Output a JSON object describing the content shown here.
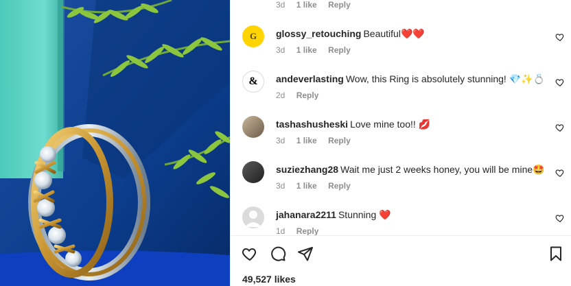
{
  "post": {
    "image_alt": "Gold and platinum diamond ring on turquoise and blue background with evergreen branches"
  },
  "comments": [
    {
      "username": "",
      "text": "",
      "time": "3d",
      "likes": "1 like",
      "reply": "Reply",
      "avatar": "dark-avatar"
    },
    {
      "username": "glossy_retouching",
      "text": "Beautiful",
      "emoji": "❤️❤️",
      "time": "3d",
      "likes": "1 like",
      "reply": "Reply",
      "avatar_text": "G"
    },
    {
      "username": "andeverlasting",
      "text": "Wow, this Ring is absolutely stunning!",
      "emoji": "💎✨💍",
      "time": "2d",
      "likes": "",
      "reply": "Reply",
      "avatar_text": "&"
    },
    {
      "username": "tashashusheski",
      "text": "Love mine too!!",
      "emoji": "💋",
      "time": "3d",
      "likes": "1 like",
      "reply": "Reply"
    },
    {
      "username": "suziezhang28",
      "text": "Wait me just 2 weeks honey, you will be mine",
      "emoji": "🤩",
      "time": "3d",
      "likes": "1 like",
      "reply": "Reply"
    },
    {
      "username": "jahanara2211",
      "text": "Stunning",
      "emoji": "❤️",
      "time": "1d",
      "likes": "",
      "reply": "Reply"
    }
  ],
  "actions": {
    "likes_count": "49,527 likes"
  },
  "colors": {
    "text": "#262626",
    "muted": "#8e8e8e",
    "heart_red": "#ed4956",
    "teal": "#5fd3c6",
    "deep_blue": "#0b3d8c"
  }
}
